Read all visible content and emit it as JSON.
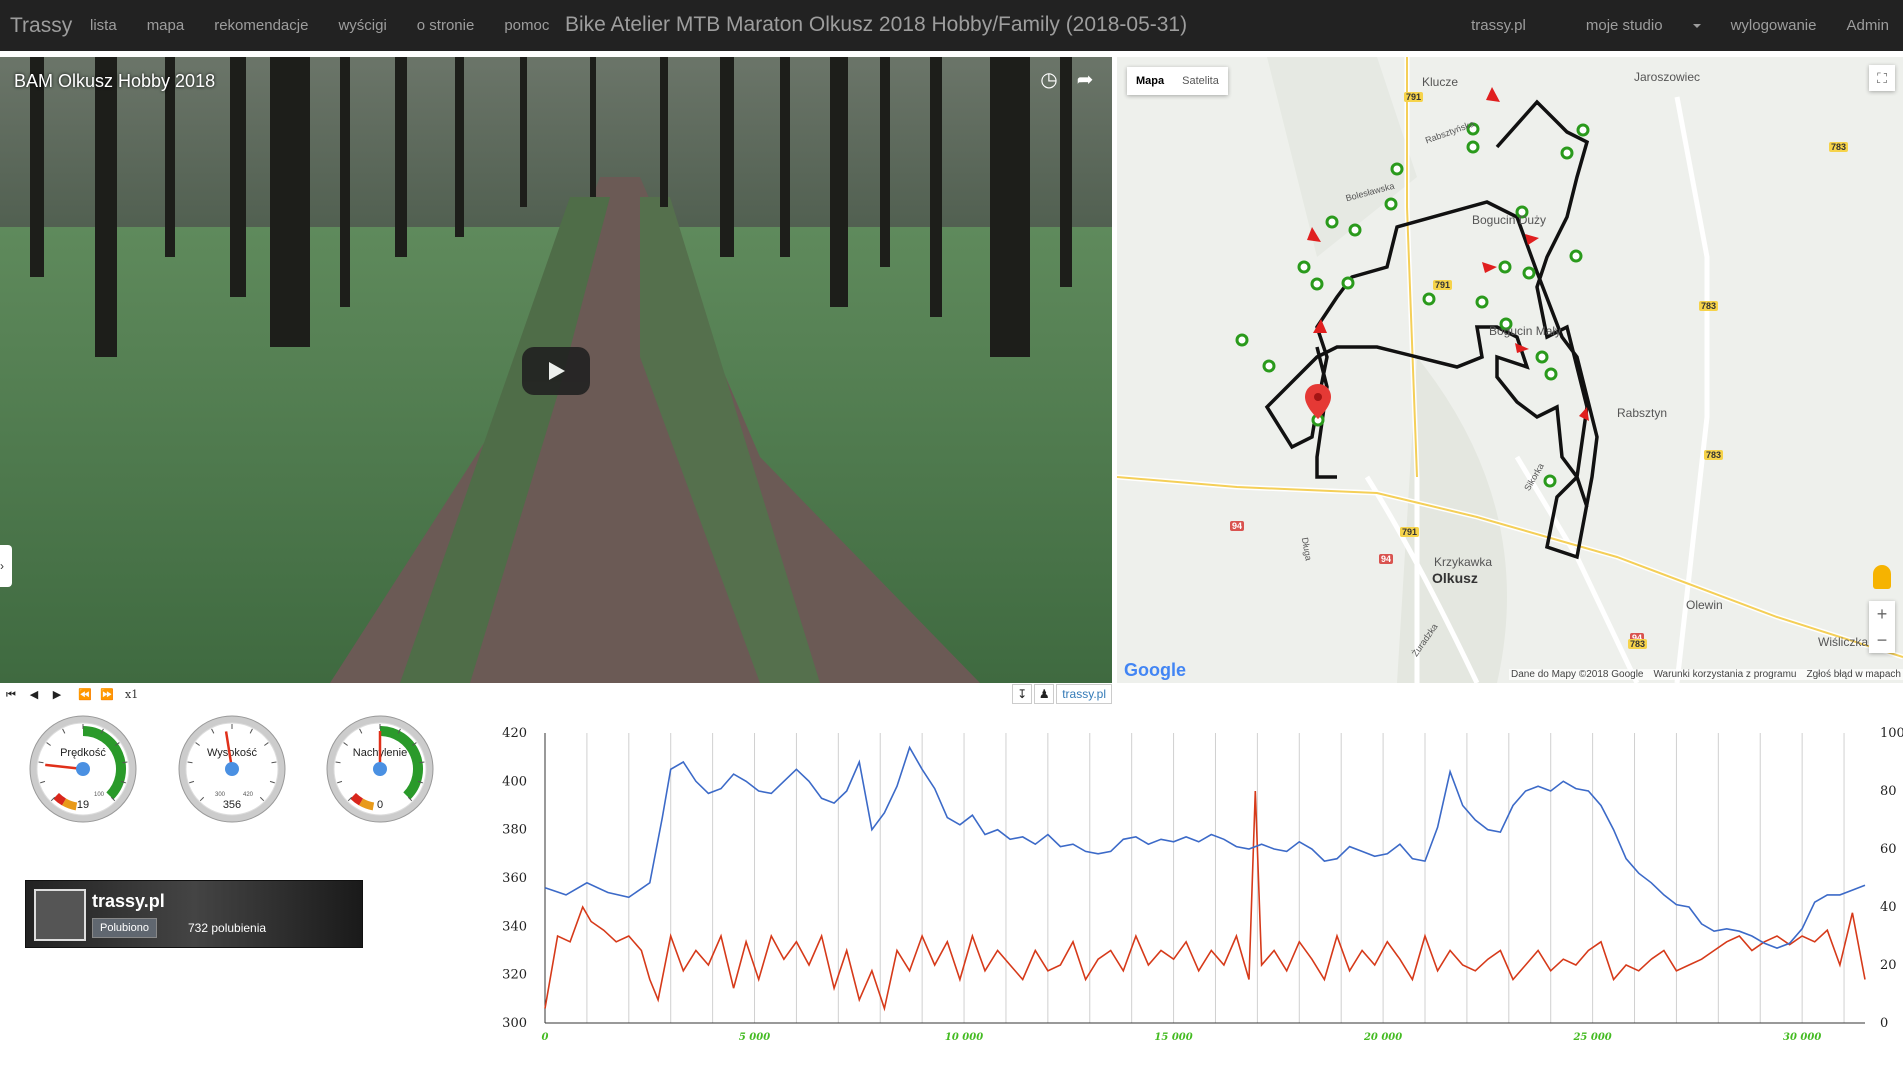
{
  "navbar": {
    "brand": "Trassy",
    "items": [
      "lista",
      "mapa",
      "rekomendacje",
      "wyścigi",
      "o stronie",
      "pomoc"
    ],
    "title": "Bike Atelier MTB Maraton Olkusz 2018 Hobby/Family (2018-05-31)",
    "right_items": [
      "trassy.pl",
      "moje studio",
      "wylogowanie",
      "Admin"
    ]
  },
  "video": {
    "title": "BAM Olkusz Hobby 2018",
    "icons": [
      "clock-icon",
      "share-icon"
    ],
    "play_icon": "play-icon"
  },
  "map": {
    "type_buttons": [
      "Mapa",
      "Satelita"
    ],
    "active_type": "Mapa",
    "google": "Google",
    "footer": [
      "Dane do Mapy ©2018 Google",
      "Warunki korzystania z programu",
      "Zgłoś błąd w mapach"
    ],
    "places": [
      "Klucze",
      "Jaroszowiec",
      "Bogucin Duży",
      "Bogucin Mały",
      "Rabsztyn",
      "Krzykawka",
      "Olkusz",
      "Olewin",
      "Wiśliczka"
    ],
    "roads": [
      "791",
      "783",
      "94",
      "791",
      "783",
      "783",
      "94",
      "791",
      "94",
      "783"
    ],
    "streets": [
      "Rabsztyńska",
      "Bolesławska",
      "Długa",
      "Sikorka",
      "Żuradzka"
    ],
    "zoom": [
      "+",
      "−"
    ]
  },
  "controls": {
    "buttons": [
      "first-icon",
      "prev-frame-icon",
      "next-frame-icon",
      "rewind-icon",
      "fast-forward-icon"
    ],
    "speed": "x1",
    "link": "trassy.pl"
  },
  "gauges": [
    {
      "label": "Prędkość",
      "value": "19",
      "max": "100",
      "value_num": 19,
      "range": [
        0,
        100
      ]
    },
    {
      "label": "Wysokość",
      "value": "356",
      "min": "300",
      "max": "420",
      "value_num": 356,
      "range": [
        300,
        420
      ]
    },
    {
      "label": "Nachylenie",
      "value": "0",
      "value_num": 0,
      "range": [
        -50,
        50
      ]
    }
  ],
  "fb": {
    "name": "trassy.pl",
    "like": "Polubiono",
    "count": "732 polubienia"
  },
  "chart_data": {
    "type": "line",
    "left_axis": {
      "ticks": [
        300,
        320,
        340,
        360,
        380,
        400,
        420
      ],
      "ylim": [
        300,
        420
      ]
    },
    "right_axis": {
      "ticks": [
        0,
        20,
        40,
        60,
        80,
        100
      ],
      "ylim": [
        0,
        100
      ]
    },
    "x_axis": {
      "ticks": [
        "0",
        "5 000",
        "10 000",
        "15 000",
        "20 000",
        "25 000",
        "30 000"
      ],
      "xlim": [
        0,
        31500
      ]
    },
    "grid": "vertical",
    "colors": {
      "elevation": "#3c6ac8",
      "speed": "#d63a1a",
      "x_ticks": "#44bb22"
    },
    "series": [
      {
        "axis": "left",
        "x": [
          0,
          500,
          1000,
          1500,
          2000,
          2500,
          2800,
          3000,
          3300,
          3600,
          3900,
          4200,
          4500,
          4800,
          5100,
          5400,
          5700,
          6000,
          6300,
          6600,
          6900,
          7200,
          7500,
          7800,
          8100,
          8400,
          8700,
          9000,
          9300,
          9600,
          9900,
          10200,
          10500,
          10800,
          11100,
          11400,
          11700,
          12000,
          12300,
          12600,
          12900,
          13200,
          13500,
          13800,
          14100,
          14400,
          14700,
          15000,
          15300,
          15600,
          15900,
          16200,
          16500,
          16800,
          17100,
          17400,
          17700,
          18000,
          18300,
          18600,
          18900,
          19200,
          19500,
          19800,
          20100,
          20400,
          20700,
          21000,
          21300,
          21600,
          21900,
          22200,
          22500,
          22800,
          23100,
          23400,
          23700,
          24000,
          24300,
          24600,
          24900,
          25200,
          25500,
          25800,
          26100,
          26400,
          26700,
          27000,
          27300,
          27600,
          27900,
          28200,
          28500,
          28800,
          29100,
          29400,
          29700,
          30000,
          30300,
          30600,
          30900,
          31200,
          31500
        ],
        "y": [
          356,
          353,
          358,
          354,
          352,
          358,
          385,
          405,
          408,
          400,
          395,
          397,
          403,
          400,
          396,
          395,
          400,
          405,
          400,
          393,
          391,
          396,
          408,
          380,
          387,
          398,
          414,
          405,
          397,
          385,
          382,
          386,
          378,
          380,
          376,
          377,
          374,
          378,
          373,
          374,
          371,
          370,
          371,
          376,
          377,
          374,
          376,
          375,
          377,
          375,
          378,
          376,
          373,
          372,
          374,
          372,
          371,
          375,
          372,
          367,
          368,
          373,
          371,
          369,
          370,
          374,
          368,
          367,
          381,
          404,
          390,
          384,
          380,
          379,
          390,
          396,
          398,
          396,
          400,
          397,
          396,
          390,
          380,
          368,
          362,
          358,
          353,
          349,
          348,
          341,
          338,
          339,
          338,
          336,
          333,
          331,
          333,
          339,
          350,
          353,
          353,
          355,
          357
        ]
      },
      {
        "axis": "right",
        "x": [
          0,
          300,
          600,
          900,
          1100,
          1400,
          1700,
          2000,
          2300,
          2500,
          2700,
          3000,
          3300,
          3600,
          3900,
          4200,
          4500,
          4800,
          5100,
          5400,
          5700,
          6000,
          6300,
          6600,
          6900,
          7200,
          7500,
          7800,
          8100,
          8400,
          8700,
          9000,
          9300,
          9600,
          9900,
          10200,
          10500,
          10800,
          11100,
          11400,
          11700,
          12000,
          12300,
          12600,
          12900,
          13200,
          13500,
          13800,
          14100,
          14400,
          14700,
          15000,
          15300,
          15600,
          15900,
          16200,
          16500,
          16800,
          16950,
          17100,
          17400,
          17700,
          18000,
          18300,
          18600,
          18900,
          19200,
          19500,
          19800,
          20100,
          20400,
          20700,
          21000,
          21300,
          21600,
          21900,
          22200,
          22500,
          22800,
          23100,
          23400,
          23700,
          24000,
          24300,
          24600,
          24900,
          25200,
          25500,
          25800,
          26100,
          26400,
          26700,
          27000,
          27300,
          27600,
          27900,
          28200,
          28500,
          28800,
          29100,
          29400,
          29700,
          30000,
          30300,
          30600,
          30900,
          31200,
          31500
        ],
        "y": [
          5,
          30,
          28,
          40,
          35,
          32,
          28,
          30,
          25,
          15,
          8,
          30,
          18,
          25,
          20,
          30,
          12,
          28,
          15,
          30,
          22,
          28,
          20,
          30,
          12,
          25,
          8,
          18,
          5,
          25,
          18,
          30,
          20,
          28,
          15,
          30,
          18,
          25,
          20,
          15,
          25,
          18,
          20,
          28,
          15,
          22,
          25,
          18,
          30,
          20,
          25,
          22,
          28,
          18,
          25,
          20,
          30,
          15,
          80,
          20,
          25,
          18,
          28,
          22,
          15,
          30,
          18,
          25,
          20,
          28,
          22,
          15,
          30,
          18,
          25,
          20,
          18,
          22,
          25,
          15,
          20,
          25,
          18,
          22,
          20,
          25,
          28,
          15,
          20,
          18,
          22,
          25,
          18,
          20,
          22,
          25,
          28,
          30,
          25,
          28,
          30,
          27,
          30,
          28,
          32,
          20,
          38,
          15
        ]
      }
    ]
  }
}
